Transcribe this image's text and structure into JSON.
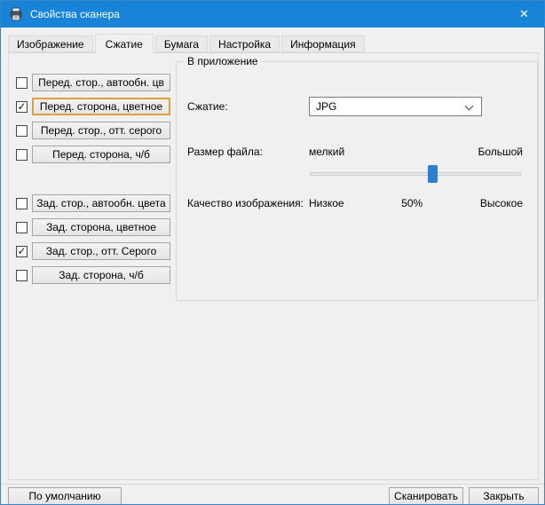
{
  "window": {
    "title": "Свойства сканера",
    "close_glyph": "✕"
  },
  "tabs": [
    {
      "label": "Изображение",
      "active": false
    },
    {
      "label": "Сжатие",
      "active": true
    },
    {
      "label": "Бумага",
      "active": false
    },
    {
      "label": "Настройка",
      "active": false
    },
    {
      "label": "Информация",
      "active": false
    }
  ],
  "sides": {
    "front": [
      {
        "label": "Перед. стор., автообн. цв",
        "checked": false,
        "highlighted": false
      },
      {
        "label": "Перед. сторона, цветное",
        "checked": true,
        "highlighted": true
      },
      {
        "label": "Перед. стор., отт. серого",
        "checked": false,
        "highlighted": false
      },
      {
        "label": "Перед. сторона, ч/б",
        "checked": false,
        "highlighted": false
      }
    ],
    "back": [
      {
        "label": "Зад. стор., автообн. цвета",
        "checked": false,
        "highlighted": false
      },
      {
        "label": "Зад. сторона, цветное",
        "checked": false,
        "highlighted": false
      },
      {
        "label": "Зад. стор., отт. Серого",
        "checked": true,
        "highlighted": false
      },
      {
        "label": "Зад. сторона, ч/б",
        "checked": false,
        "highlighted": false
      }
    ]
  },
  "group": {
    "title": "В приложение",
    "compression_label": "Сжатие:",
    "compression_value": "JPG",
    "file_size_label": "Размер файла:",
    "file_size_min": "мелкий",
    "file_size_max": "Большой",
    "slider_percent": 58,
    "quality_label": "Качество изображения:",
    "quality_min": "Низкое",
    "quality_value": "50%",
    "quality_max": "Высокое"
  },
  "footer": {
    "default": "По умолчанию",
    "scan": "Сканировать",
    "close": "Закрыть"
  },
  "icons": {
    "check": "✓"
  },
  "colors": {
    "titlebar": "#1884d8",
    "accent": "#2d7dd2",
    "highlight": "#dd9f3c"
  }
}
